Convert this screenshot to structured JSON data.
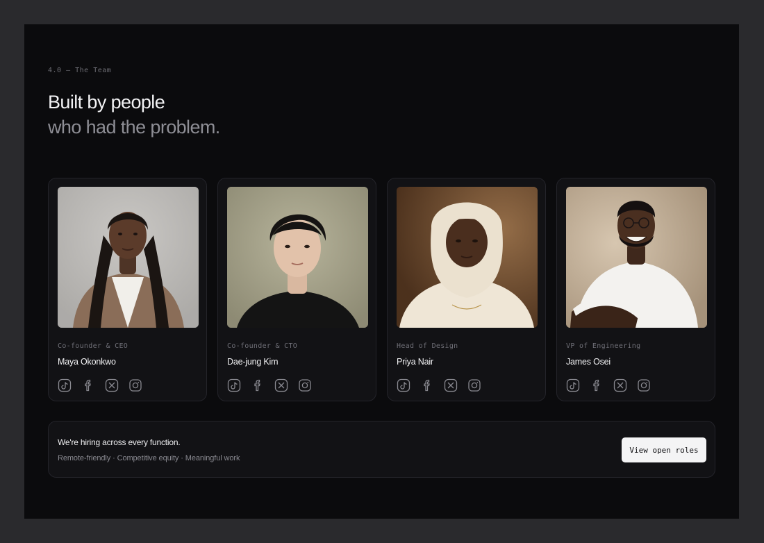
{
  "section": {
    "eyebrow": "4.0 — The Team",
    "headline_line1": "Built by people",
    "headline_line2": "who had the problem."
  },
  "team": [
    {
      "role": "Co-founder & CEO",
      "name": "Maya Okonkwo"
    },
    {
      "role": "Co-founder & CTO",
      "name": "Dae-jung Kim"
    },
    {
      "role": "Head of Design",
      "name": "Priya Nair"
    },
    {
      "role": "VP of Engineering",
      "name": "James Osei"
    }
  ],
  "social_icons": [
    "tiktok-icon",
    "facebook-icon",
    "x-icon",
    "instagram-icon"
  ],
  "hiring": {
    "title": "We're hiring across every function.",
    "subtitle": "Remote-friendly · Competitive equity · Meaningful work",
    "cta_label": "View open roles"
  },
  "colors": {
    "page_background": "#0b0b0d",
    "card_background": "#121215",
    "card_border": "#24242a",
    "cta_background": "#f4f4f5"
  }
}
